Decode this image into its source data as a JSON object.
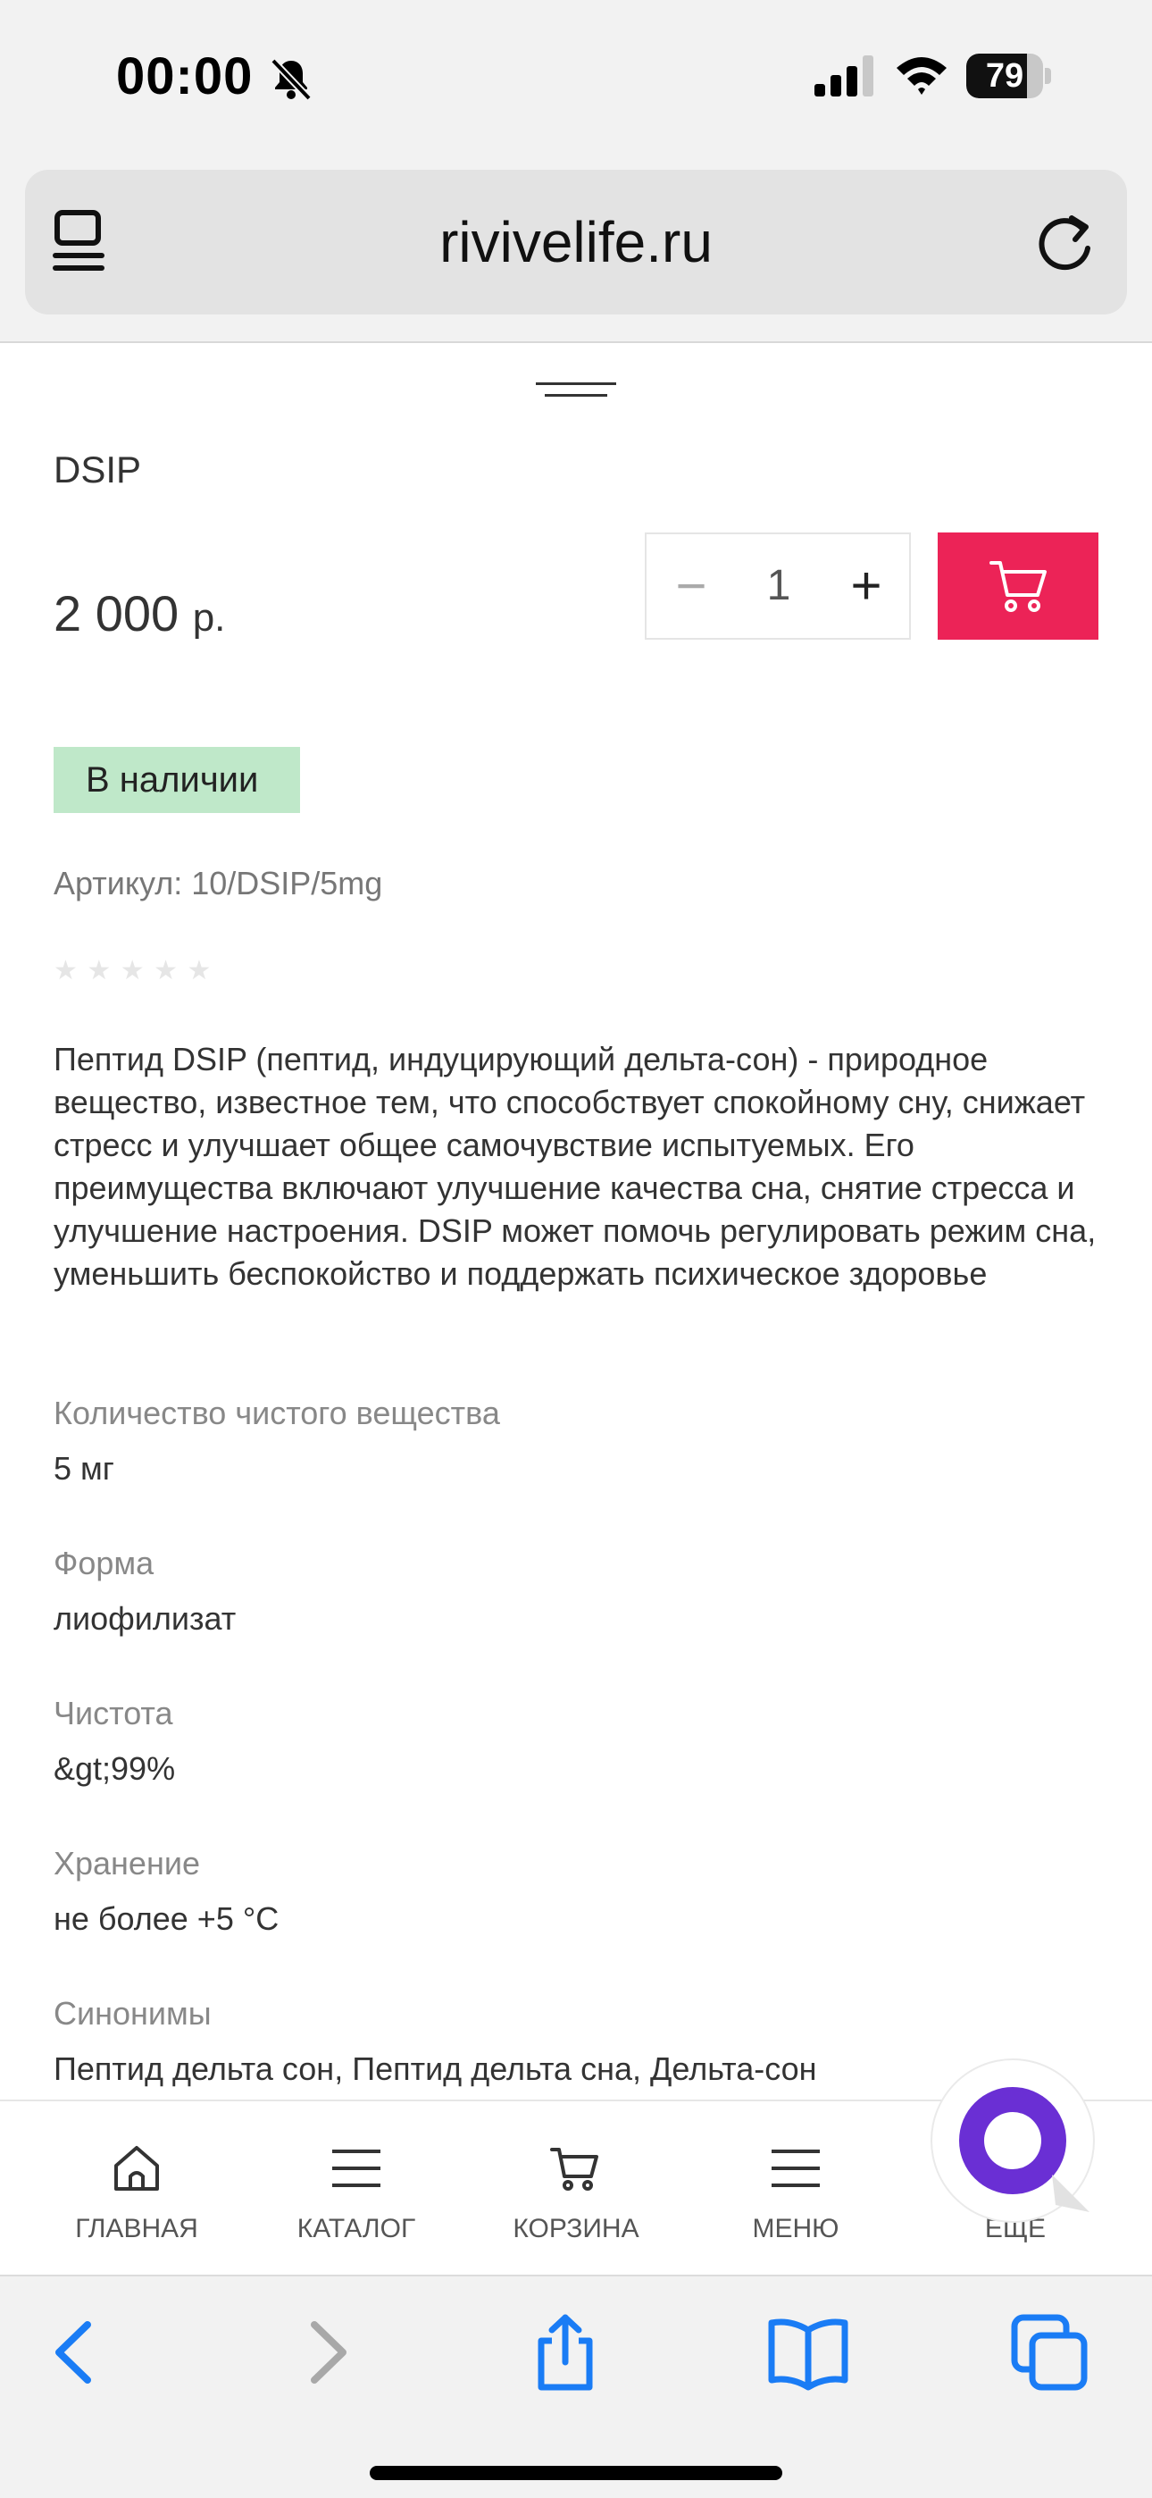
{
  "status_bar": {
    "time": "00:00",
    "battery": "79",
    "battery_level": 0.79
  },
  "browser": {
    "url": "rivivelife.ru"
  },
  "product": {
    "title": "DSIP",
    "price": "2 000",
    "currency": "р.",
    "quantity": "1",
    "minus_label": "−",
    "plus_label": "+",
    "availability": "В наличии",
    "sku_label": "Артикул: ",
    "sku_value": "10/DSIP/5mg",
    "rating_stars": [
      "★",
      "★",
      "★",
      "★",
      "★"
    ],
    "description": "Пептид DSIP (пептид, индуцирующий дельта-сон) - природное вещество, известное тем, что способствует спокойному сну, снижает стресс и улучшает общее самочувствие испытуемых. Его преимущества включают улучшение качества сна, снятие стресса и улучшение настроения. DSIP может помочь регулировать режим сна, уменьшить беспокойство и поддержать психическое здоровье",
    "properties": [
      {
        "label": "Количество чистого вещества",
        "value": "5 мг"
      },
      {
        "label": "Форма",
        "value": "лиофилизат"
      },
      {
        "label": "Чистота",
        "value": "&gt;99%"
      },
      {
        "label": "Хранение",
        "value": "не более +5 °C"
      },
      {
        "label": "Синонимы",
        "value": "Пептид дельта сон, Пептид дельта сна, Дельта-сон"
      }
    ]
  },
  "bottom_nav": {
    "items": [
      {
        "label": "ГЛАВНАЯ",
        "icon": "home-icon"
      },
      {
        "label": "КАТАЛОГ",
        "icon": "catalog-icon"
      },
      {
        "label": "КОРЗИНА",
        "icon": "cart-icon"
      },
      {
        "label": "МЕНЮ",
        "icon": "menu-icon"
      },
      {
        "label": "ЕЩЕ",
        "icon": "more-icon"
      }
    ]
  },
  "colors": {
    "accent": "#ec2357",
    "badge": "#bfe8c9",
    "chat": "#6a2fd4",
    "safari_blue": "#1a7cf5"
  }
}
